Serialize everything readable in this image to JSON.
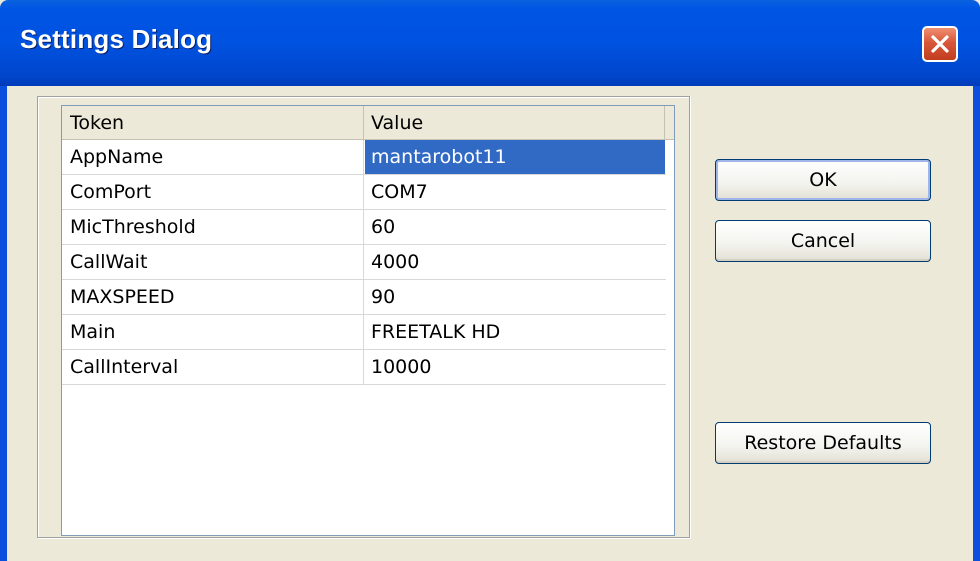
{
  "window": {
    "title": "Settings Dialog"
  },
  "grid": {
    "columns": [
      "Token",
      "Value"
    ],
    "rows": [
      {
        "token": "AppName",
        "value": "mantarobot11"
      },
      {
        "token": "ComPort",
        "value": "COM7"
      },
      {
        "token": "MicThreshold",
        "value": "60"
      },
      {
        "token": "CallWait",
        "value": "4000"
      },
      {
        "token": "MAXSPEED",
        "value": "90"
      },
      {
        "token": "Main",
        "value": "FREETALK HD"
      },
      {
        "token": "CallInterval",
        "value": "10000"
      }
    ],
    "selected_row": "AppName"
  },
  "buttons": {
    "ok": "OK",
    "cancel": "Cancel",
    "restore": "Restore Defaults"
  },
  "icons": {
    "close": "close-icon"
  },
  "colors": {
    "titlebar": "#0055e5",
    "close_button": "#d8573a",
    "selection": "#316ac5",
    "dialog_background": "#ece9d8"
  }
}
